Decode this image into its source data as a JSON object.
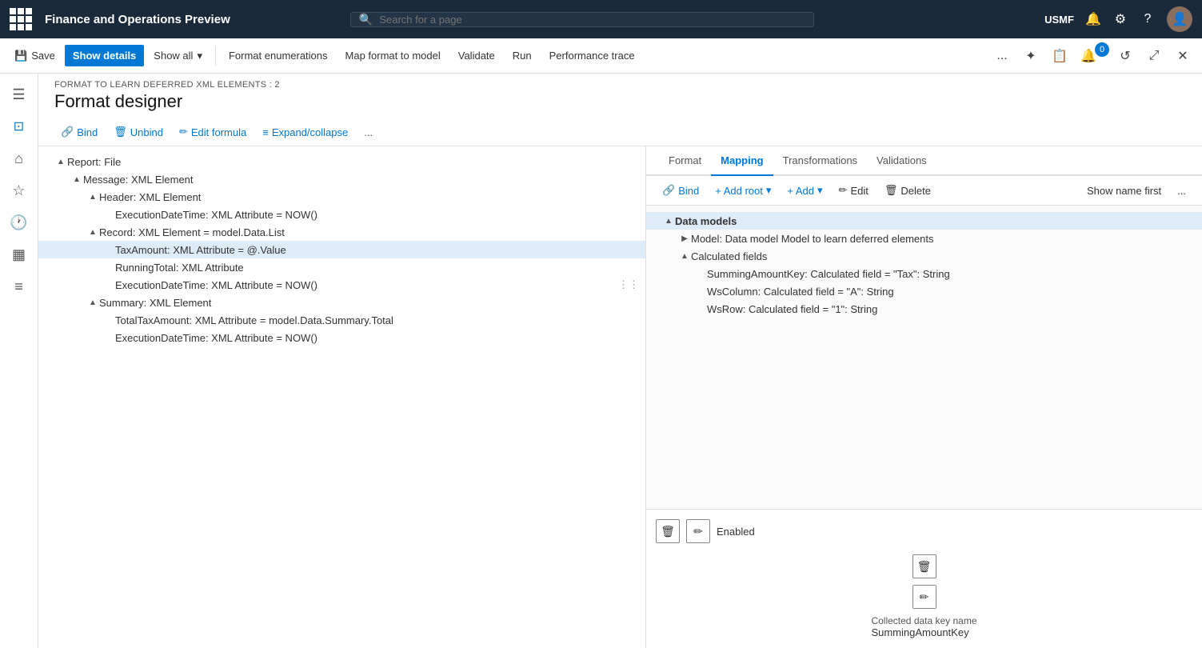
{
  "topNav": {
    "appTitle": "Finance and Operations Preview",
    "searchPlaceholder": "Search for a page",
    "username": "USMF"
  },
  "toolbar": {
    "saveLabel": "Save",
    "showDetailsLabel": "Show details",
    "showAllLabel": "Show all",
    "formatEnumerationsLabel": "Format enumerations",
    "mapFormatToModelLabel": "Map format to model",
    "validateLabel": "Validate",
    "runLabel": "Run",
    "performanceTraceLabel": "Performance trace",
    "moreLabel": "...",
    "badgeCount": "0"
  },
  "page": {
    "subtitle": "FORMAT TO LEARN DEFERRED XML ELEMENTS : 2",
    "title": "Format designer"
  },
  "contentToolbar": {
    "bindLabel": "Bind",
    "unbindLabel": "Unbind",
    "editFormulaLabel": "Edit formula",
    "expandCollapseLabel": "Expand/collapse",
    "moreLabel": "..."
  },
  "formatTree": {
    "items": [
      {
        "indent": 1,
        "toggle": "▲",
        "label": "Report: File",
        "selected": false
      },
      {
        "indent": 2,
        "toggle": "▲",
        "label": "Message: XML Element",
        "selected": false
      },
      {
        "indent": 3,
        "toggle": "▲",
        "label": "Header: XML Element",
        "selected": false
      },
      {
        "indent": 4,
        "toggle": "",
        "label": "ExecutionDateTime: XML Attribute = NOW()",
        "selected": false
      },
      {
        "indent": 3,
        "toggle": "▲",
        "label": "Record: XML Element = model.Data.List",
        "selected": false
      },
      {
        "indent": 4,
        "toggle": "",
        "label": "TaxAmount: XML Attribute = @.Value",
        "selected": true
      },
      {
        "indent": 4,
        "toggle": "",
        "label": "RunningTotal: XML Attribute",
        "selected": false
      },
      {
        "indent": 4,
        "toggle": "",
        "label": "ExecutionDateTime: XML Attribute = NOW()",
        "selected": false,
        "hasIndicator": true
      },
      {
        "indent": 3,
        "toggle": "▲",
        "label": "Summary: XML Element",
        "selected": false
      },
      {
        "indent": 4,
        "toggle": "",
        "label": "TotalTaxAmount: XML Attribute = model.Data.Summary.Total",
        "selected": false
      },
      {
        "indent": 4,
        "toggle": "",
        "label": "ExecutionDateTime: XML Attribute = NOW()",
        "selected": false
      }
    ]
  },
  "rightPanel": {
    "tabs": [
      {
        "label": "Format",
        "active": false
      },
      {
        "label": "Mapping",
        "active": true
      },
      {
        "label": "Transformations",
        "active": false
      },
      {
        "label": "Validations",
        "active": false
      }
    ],
    "toolbar": {
      "bindLabel": "Bind",
      "addRootLabel": "+ Add root",
      "addLabel": "+ Add",
      "editLabel": "Edit",
      "deleteLabel": "Delete",
      "showNameFirstLabel": "Show name first",
      "moreLabel": "..."
    },
    "dataTree": {
      "items": [
        {
          "indent": 0,
          "toggle": "▲",
          "label": "Data models",
          "selected": true
        },
        {
          "indent": 1,
          "toggle": "▶",
          "label": "Model: Data model Model to learn deferred elements",
          "selected": false
        },
        {
          "indent": 1,
          "toggle": "▲",
          "label": "Calculated fields",
          "selected": false
        },
        {
          "indent": 2,
          "toggle": "",
          "label": "SummingAmountKey: Calculated field = \"Tax\": String",
          "selected": false
        },
        {
          "indent": 2,
          "toggle": "",
          "label": "WsColumn: Calculated field = \"A\": String",
          "selected": false
        },
        {
          "indent": 2,
          "toggle": "",
          "label": "WsRow: Calculated field = \"1\": String",
          "selected": false
        }
      ]
    },
    "bottomActions": [
      {
        "type": "action-row",
        "statusLabel": "Enabled"
      },
      {
        "type": "field-row",
        "fieldLabel": "Collected data key name",
        "fieldValue": "SummingAmountKey"
      }
    ]
  }
}
